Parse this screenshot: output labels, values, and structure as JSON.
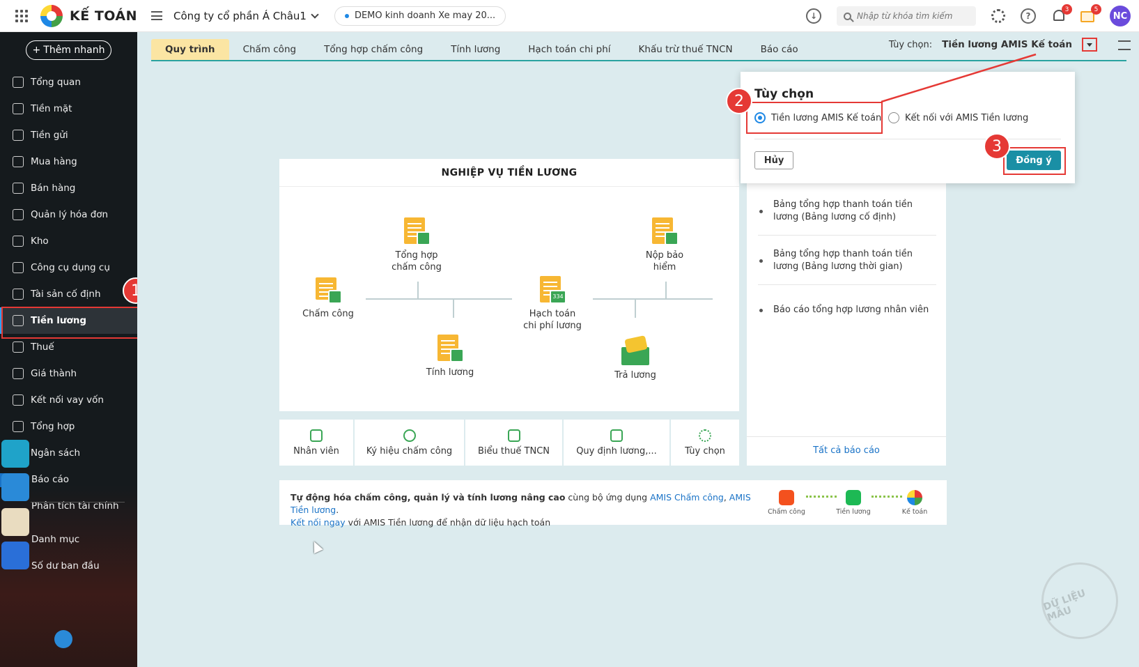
{
  "topbar": {
    "brand": "KẾ TOÁN",
    "company": "Công ty cổ phần Á Châu1",
    "database": "DEMO kinh doanh Xe may 20...",
    "search_placeholder": "Nhập từ khóa tìm kiếm",
    "notifications_count": "3",
    "gifts_count": "5",
    "avatar_initials": "NC"
  },
  "sidebar": {
    "add_button": "Thêm nhanh",
    "items": [
      {
        "label": "Tổng quan",
        "icon": "chart-icon"
      },
      {
        "label": "Tiền mặt",
        "icon": "money-bag-icon"
      },
      {
        "label": "Tiền gửi",
        "icon": "bank-icon"
      },
      {
        "label": "Mua hàng",
        "icon": "shopping-bag-icon"
      },
      {
        "label": "Bán hàng",
        "icon": "cart-icon"
      },
      {
        "label": "Quản lý hóa đơn",
        "icon": "invoice-icon"
      },
      {
        "label": "Kho",
        "icon": "warehouse-icon"
      },
      {
        "label": "Công cụ dụng cụ",
        "icon": "tools-icon"
      },
      {
        "label": "Tài sản cố định",
        "icon": "car-icon"
      },
      {
        "label": "Tiền lương",
        "icon": "salary-icon",
        "active": true
      },
      {
        "label": "Thuế",
        "icon": "tax-icon"
      },
      {
        "label": "Giá thành",
        "icon": "price-tag-icon"
      },
      {
        "label": "Kết nối vay vốn",
        "icon": "link-icon"
      },
      {
        "label": "Tổng hợp",
        "icon": "summary-icon"
      },
      {
        "label": "Ngân sách",
        "icon": "budget-icon"
      },
      {
        "label": "Báo cáo",
        "icon": "report-icon"
      },
      {
        "label": "Phân tích tài chính",
        "icon": "analysis-icon"
      },
      {
        "label": "Danh mục",
        "icon": "catalog-icon"
      },
      {
        "label": "Số dư ban đầu",
        "icon": "balance-icon"
      }
    ],
    "step_1": "1"
  },
  "tabs": {
    "items": [
      "Quy trình",
      "Chấm công",
      "Tổng hợp chấm công",
      "Tính lương",
      "Hạch toán chi phí",
      "Khấu trừ thuế TNCN",
      "Báo cáo"
    ],
    "option_label": "Tùy chọn:",
    "option_value": "Tiền lương AMIS Kế toán"
  },
  "diagram": {
    "title": "NGHIỆP VỤ TIỀN LƯƠNG",
    "nodes": {
      "cham_cong": "Chấm công",
      "tong_hop_1": "Tổng hợp",
      "tong_hop_2": "chấm công",
      "tinh_luong": "Tính lương",
      "hach_toan_1": "Hạch toán",
      "hach_toan_2": "chi phí lương",
      "nop_bao_1": "Nộp bảo",
      "nop_bao_2": "hiểm",
      "tra_luong": "Trả lương",
      "badge_334": "334"
    }
  },
  "shortcuts": [
    "Nhân viên",
    "Ký hiệu chấm công",
    "Biểu thuế TNCN",
    "Quy định lương,...",
    "Tùy chọn"
  ],
  "reports": {
    "items": [
      "Bảng tổng hợp thanh toán tiền lương (Bảng lương cố định)",
      "Bảng tổng hợp thanh toán tiền lương (Bảng lương thời gian)",
      "Báo cáo tổng hợp lương nhân viên"
    ],
    "all_link": "Tất cả báo cáo"
  },
  "popup": {
    "title": "Tùy chọn",
    "option_1": "Tiền lương AMIS Kế toán",
    "option_2": "Kết nối với AMIS Tiền lương",
    "cancel": "Hủy",
    "ok": "Đồng ý",
    "step_2": "2",
    "step_3": "3"
  },
  "promo": {
    "bold": "Tự động hóa chấm công, quản lý và tính lương nâng cao",
    "text_1": " cùng bộ ứng dụng ",
    "link_1": "AMIS Chấm công",
    "comma": ", ",
    "link_2": "AMIS Tiền lương",
    "period": ".",
    "link_3": "Kết nối ngay",
    "text_2": " với AMIS Tiền lương để nhận dữ liệu hạch toán",
    "apps": [
      "Chấm công",
      "Tiền lương",
      "Kế toán"
    ]
  },
  "watermark": "DỮ LIỆU MẪU",
  "colors": {
    "sidebar_bg": "#151a1d",
    "main_bg": "#dcebee",
    "accent": "#1a8fa5",
    "highlight_red": "#e53935",
    "active_tab": "#fbe5a3"
  }
}
